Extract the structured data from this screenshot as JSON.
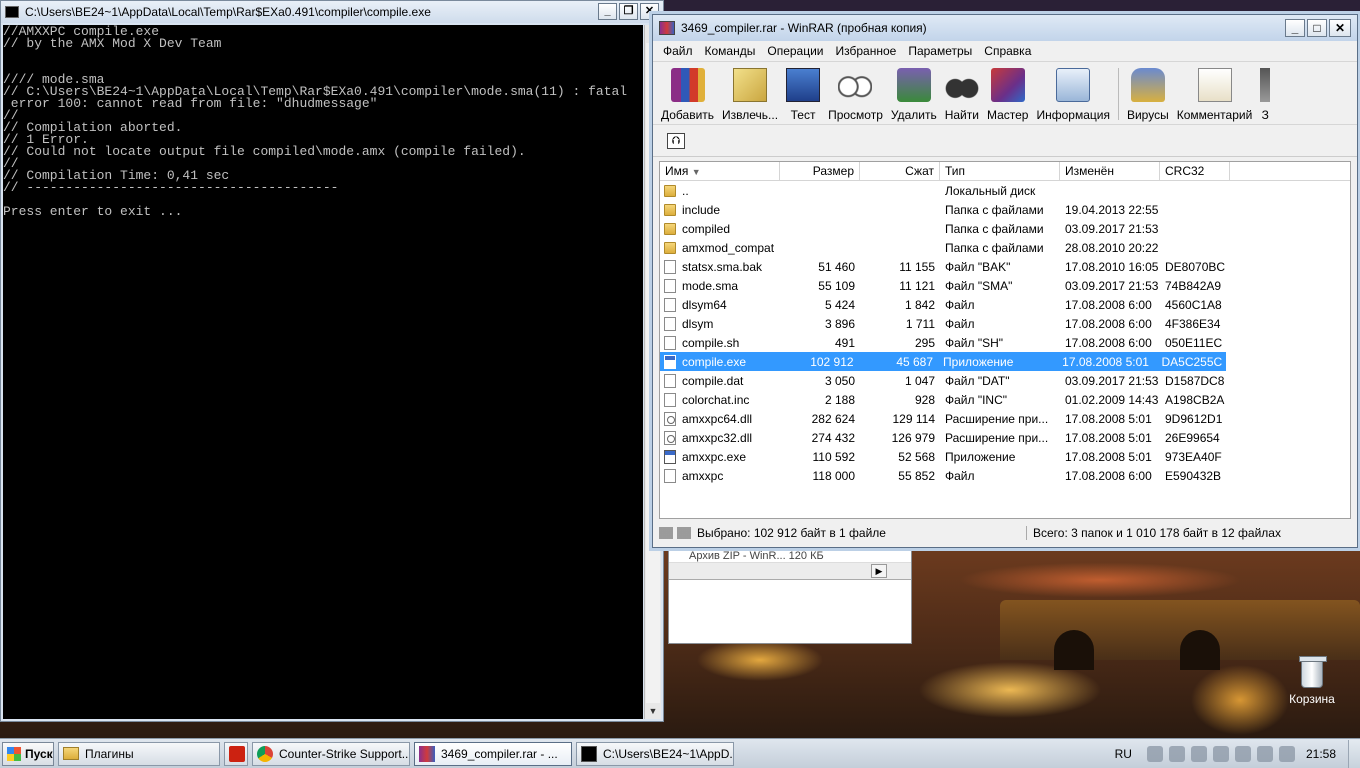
{
  "desktop": {
    "recycle_bin_label": "Корзина"
  },
  "bg_panel": {
    "row_text": "Архив ZIP - WinR...      120 КБ"
  },
  "console": {
    "title": "C:\\Users\\BE24~1\\AppData\\Local\\Temp\\Rar$EXa0.491\\compiler\\compile.exe",
    "lines": [
      "//AMXXPC compile.exe",
      "// by the AMX Mod X Dev Team",
      "",
      "",
      "//// mode.sma",
      "// C:\\Users\\BE24~1\\AppData\\Local\\Temp\\Rar$EXa0.491\\compiler\\mode.sma(11) : fatal",
      " error 100: cannot read from file: \"dhudmessage\"",
      "//",
      "// Compilation aborted.",
      "// 1 Error.",
      "// Could not locate output file compiled\\mode.amx (compile failed).",
      "//",
      "// Compilation Time: 0,41 sec",
      "// ----------------------------------------",
      "",
      "Press enter to exit ..."
    ]
  },
  "winrar": {
    "title": "3469_compiler.rar - WinRAR (пробная копия)",
    "menu": [
      "Файл",
      "Команды",
      "Операции",
      "Избранное",
      "Параметры",
      "Справка"
    ],
    "toolbar": [
      {
        "label": "Добавить",
        "icon": "add-archive-icon"
      },
      {
        "label": "Извлечь...",
        "icon": "extract-icon"
      },
      {
        "label": "Тест",
        "icon": "test-icon"
      },
      {
        "label": "Просмотр",
        "icon": "view-icon"
      },
      {
        "label": "Удалить",
        "icon": "delete-icon"
      },
      {
        "label": "Найти",
        "icon": "find-icon"
      },
      {
        "label": "Мастер",
        "icon": "wizard-icon"
      },
      {
        "label": "Информация",
        "icon": "info-icon"
      },
      {
        "label": "Вирусы",
        "icon": "virus-scan-icon"
      },
      {
        "label": "Комментарий",
        "icon": "comment-icon"
      },
      {
        "label": "З",
        "icon": "sfx-icon"
      }
    ],
    "columns": {
      "name": "Имя",
      "size": "Размер",
      "packed": "Сжат",
      "type": "Тип",
      "modified": "Изменён",
      "crc": "CRC32"
    },
    "files": [
      {
        "name": "..",
        "size": "",
        "packed": "",
        "type": "Локальный диск",
        "modified": "",
        "crc": "",
        "icon": "folder"
      },
      {
        "name": "include",
        "size": "",
        "packed": "",
        "type": "Папка с файлами",
        "modified": "19.04.2013 22:55",
        "crc": "",
        "icon": "folder"
      },
      {
        "name": "compiled",
        "size": "",
        "packed": "",
        "type": "Папка с файлами",
        "modified": "03.09.2017 21:53",
        "crc": "",
        "icon": "folder"
      },
      {
        "name": "amxmod_compat",
        "size": "",
        "packed": "",
        "type": "Папка с файлами",
        "modified": "28.08.2010 20:22",
        "crc": "",
        "icon": "folder"
      },
      {
        "name": "statsx.sma.bak",
        "size": "51 460",
        "packed": "11 155",
        "type": "Файл \"BAK\"",
        "modified": "17.08.2010 16:05",
        "crc": "DE8070BC",
        "icon": "file"
      },
      {
        "name": "mode.sma",
        "size": "55 109",
        "packed": "11 121",
        "type": "Файл \"SMA\"",
        "modified": "03.09.2017 21:53",
        "crc": "74B842A9",
        "icon": "file"
      },
      {
        "name": "dlsym64",
        "size": "5 424",
        "packed": "1 842",
        "type": "Файл",
        "modified": "17.08.2008 6:00",
        "crc": "4560C1A8",
        "icon": "file"
      },
      {
        "name": "dlsym",
        "size": "3 896",
        "packed": "1 711",
        "type": "Файл",
        "modified": "17.08.2008 6:00",
        "crc": "4F386E34",
        "icon": "file"
      },
      {
        "name": "compile.sh",
        "size": "491",
        "packed": "295",
        "type": "Файл \"SH\"",
        "modified": "17.08.2008 6:00",
        "crc": "050E11EC",
        "icon": "file"
      },
      {
        "name": "compile.exe",
        "size": "102 912",
        "packed": "45 687",
        "type": "Приложение",
        "modified": "17.08.2008 5:01",
        "crc": "DA5C255C",
        "icon": "exe",
        "selected": true
      },
      {
        "name": "compile.dat",
        "size": "3 050",
        "packed": "1 047",
        "type": "Файл \"DAT\"",
        "modified": "03.09.2017 21:53",
        "crc": "D1587DC8",
        "icon": "file"
      },
      {
        "name": "colorchat.inc",
        "size": "2 188",
        "packed": "928",
        "type": "Файл \"INC\"",
        "modified": "01.02.2009 14:43",
        "crc": "A198CB2A",
        "icon": "file"
      },
      {
        "name": "amxxpc64.dll",
        "size": "282 624",
        "packed": "129 114",
        "type": "Расширение при...",
        "modified": "17.08.2008 5:01",
        "crc": "9D9612D1",
        "icon": "dll"
      },
      {
        "name": "amxxpc32.dll",
        "size": "274 432",
        "packed": "126 979",
        "type": "Расширение при...",
        "modified": "17.08.2008 5:01",
        "crc": "26E99654",
        "icon": "dll"
      },
      {
        "name": "amxxpc.exe",
        "size": "110 592",
        "packed": "52 568",
        "type": "Приложение",
        "modified": "17.08.2008 5:01",
        "crc": "973EA40F",
        "icon": "exe"
      },
      {
        "name": "amxxpc",
        "size": "118 000",
        "packed": "55 852",
        "type": "Файл",
        "modified": "17.08.2008 6:00",
        "crc": "E590432B",
        "icon": "file"
      }
    ],
    "status_left": "Выбрано: 102 912 байт в 1 файле",
    "status_right": "Всего: 3 папок и 1 010 178 байт в 12 файлах"
  },
  "taskbar": {
    "start_label": "Пуск",
    "tasks": [
      {
        "label": "Плагины",
        "icon": "folder",
        "width": 162
      },
      {
        "label": "",
        "icon": "filezilla",
        "width": 24
      },
      {
        "label": "Counter-Strike Support...",
        "icon": "chrome",
        "width": 158
      },
      {
        "label": "3469_compiler.rar - ...",
        "icon": "winrar",
        "width": 158,
        "active": true
      },
      {
        "label": "C:\\Users\\BE24~1\\AppD...",
        "icon": "cmd",
        "width": 158
      }
    ],
    "lang": "RU",
    "clock": "21:58"
  },
  "colors": {
    "selection": "#3399ff",
    "console_bg": "#000000",
    "console_fg": "#c0c0c0"
  }
}
